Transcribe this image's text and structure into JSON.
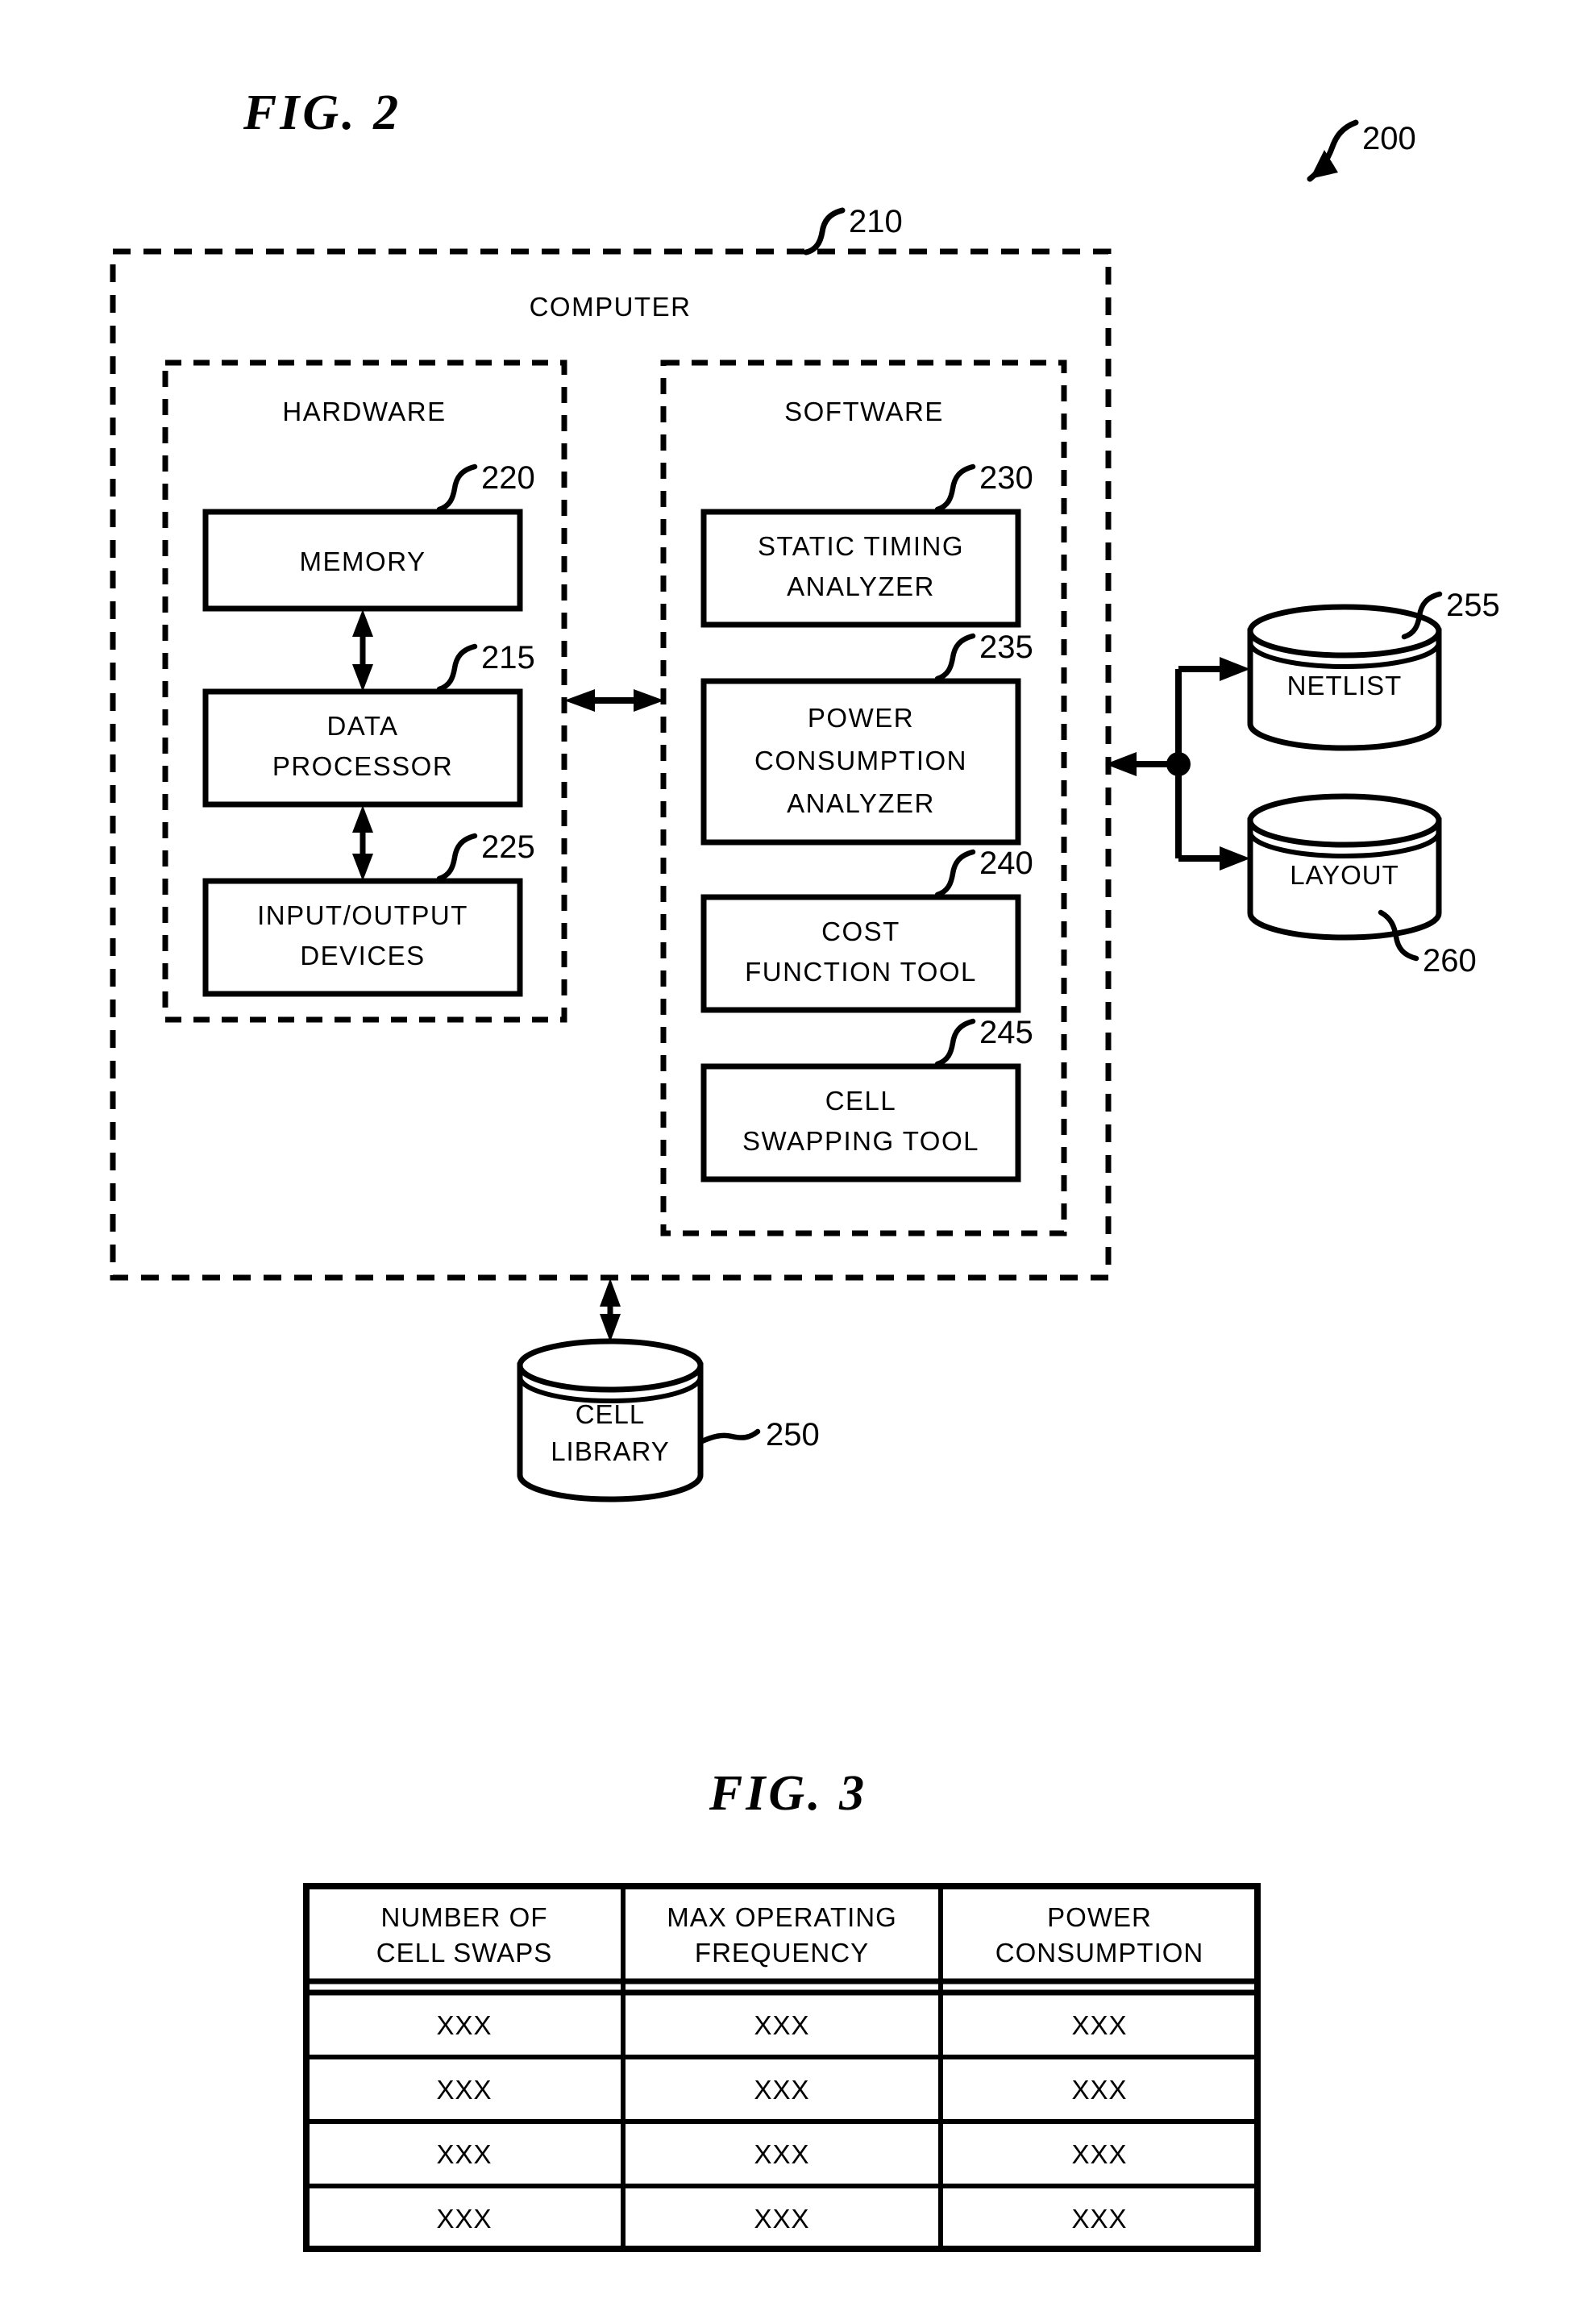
{
  "figures": [
    {
      "id": "fig2",
      "title": "FIG.  2",
      "overall_ref": "200",
      "computer": {
        "label": "COMPUTER",
        "ref": "210",
        "hardware": {
          "label": "HARDWARE",
          "blocks": [
            {
              "label_lines": [
                "MEMORY"
              ],
              "ref": "220"
            },
            {
              "label_lines": [
                "DATA",
                "PROCESSOR"
              ],
              "ref": "215"
            },
            {
              "label_lines": [
                "INPUT/OUTPUT",
                "DEVICES"
              ],
              "ref": "225"
            }
          ]
        },
        "software": {
          "label": "SOFTWARE",
          "blocks": [
            {
              "label_lines": [
                "STATIC  TIMING",
                "ANALYZER"
              ],
              "ref": "230"
            },
            {
              "label_lines": [
                "POWER",
                "CONSUMPTION",
                "ANALYZER"
              ],
              "ref": "235"
            },
            {
              "label_lines": [
                "COST",
                "FUNCTION  TOOL"
              ],
              "ref": "240"
            },
            {
              "label_lines": [
                "CELL",
                "SWAPPING  TOOL"
              ],
              "ref": "245"
            }
          ]
        }
      },
      "databases": [
        {
          "label_lines": [
            "NETLIST"
          ],
          "ref": "255"
        },
        {
          "label_lines": [
            "LAYOUT"
          ],
          "ref": "260"
        },
        {
          "label_lines": [
            "CELL",
            "LIBRARY"
          ],
          "ref": "250"
        }
      ]
    },
    {
      "id": "fig3",
      "title": "FIG.  3",
      "table": {
        "columns": [
          [
            "NUMBER OF",
            "CELL SWAPS"
          ],
          [
            "MAX OPERATING",
            "FREQUENCY"
          ],
          [
            "POWER",
            "CONSUMPTION"
          ]
        ],
        "rows": [
          [
            "XXX",
            "XXX",
            "XXX"
          ],
          [
            "XXX",
            "XXX",
            "XXX"
          ],
          [
            "XXX",
            "XXX",
            "XXX"
          ],
          [
            "XXX",
            "XXX",
            "XXX"
          ]
        ]
      }
    }
  ],
  "colors": {
    "ink": "#000000",
    "paper": "#ffffff"
  }
}
